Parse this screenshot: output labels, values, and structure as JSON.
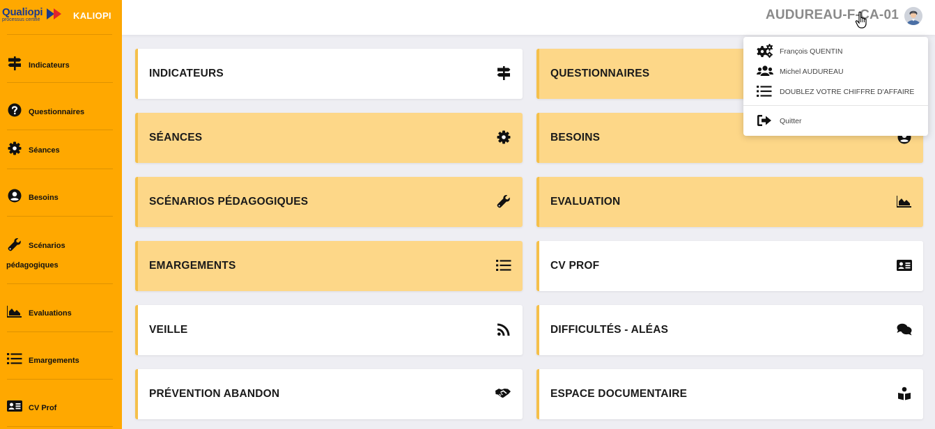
{
  "brand": {
    "logo_text": "Qualiopi",
    "logo_tagline": "processus certifié",
    "app_name": "KALIOPI"
  },
  "sidebar": {
    "items": [
      {
        "label": "Indicateurs",
        "icon": "signpost-icon"
      },
      {
        "label": "Questionnaires",
        "icon": "question-circle-icon"
      },
      {
        "label": "Séances",
        "icon": "gear-icon"
      },
      {
        "label": "Besoins",
        "icon": "user-circle-icon"
      },
      {
        "label": "Scénarios",
        "label2": "pédagogiques",
        "icon": "wrench-icon"
      },
      {
        "label": "Evaluations",
        "icon": "area-chart-icon"
      },
      {
        "label": "Emargements",
        "icon": "list-icon"
      },
      {
        "label": "CV Prof",
        "icon": "id-card-icon"
      }
    ]
  },
  "header": {
    "username": "AUDUREAU-F-CA-01"
  },
  "cards": [
    {
      "title": "INDICATEURS",
      "icon": "signpost-icon",
      "style": "white"
    },
    {
      "title": "QUESTIONNAIRES",
      "icon": "question-circle-icon",
      "style": "yellow"
    },
    {
      "title": "SÉANCES",
      "icon": "gear-icon",
      "style": "yellow"
    },
    {
      "title": "BESOINS",
      "icon": "user-circle-icon",
      "style": "yellow"
    },
    {
      "title": "SCÉNARIOS PÉDAGOGIQUES",
      "icon": "wrench-icon",
      "style": "yellow"
    },
    {
      "title": "EVALUATION",
      "icon": "area-chart-icon",
      "style": "yellow"
    },
    {
      "title": "EMARGEMENTS",
      "icon": "list-icon",
      "style": "yellow"
    },
    {
      "title": "CV PROF",
      "icon": "id-card-icon",
      "style": "white"
    },
    {
      "title": "VEILLE",
      "icon": "rss-icon",
      "style": "white"
    },
    {
      "title": "DIFFICULTÉS - ALÉAS",
      "icon": "comments-icon",
      "style": "white"
    },
    {
      "title": "PRÉVENTION ABANDON",
      "icon": "handshake-icon",
      "style": "white"
    },
    {
      "title": "ESPACE DOCUMENTAIRE",
      "icon": "book-reader-icon",
      "style": "white"
    }
  ],
  "dropdown": {
    "items": [
      {
        "label": "François QUENTIN",
        "icon": "gears-icon"
      },
      {
        "label": "Michel AUDUREAU",
        "icon": "users-icon"
      },
      {
        "label": "DOUBLEZ VOTRE CHIFFRE D'AFFAIRE",
        "icon": "list-icon"
      },
      {
        "label": "Quitter",
        "icon": "sign-out-icon"
      }
    ]
  },
  "colors": {
    "sidebar_bg": "#ffa800",
    "card_yellow": "#fdd788",
    "card_accent": "#f5c04a",
    "page_bg": "#eeeef3",
    "logo_blue": "#1b3a8c",
    "logo_red": "#e2232a"
  }
}
